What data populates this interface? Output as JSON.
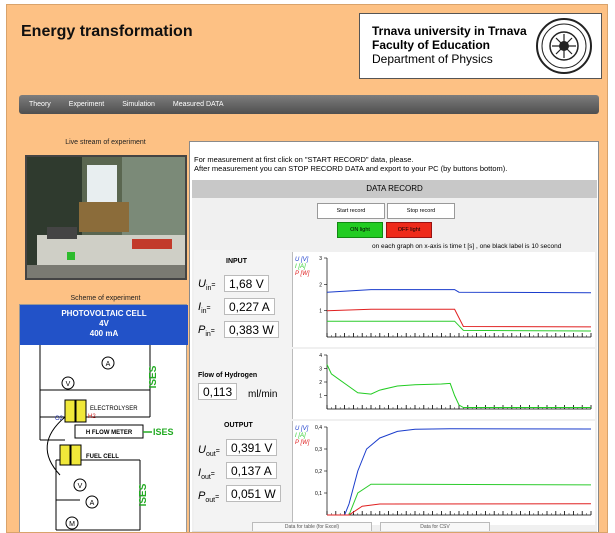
{
  "header": {
    "title": "Energy transformation",
    "university_line1": "Trnava university in Trnava",
    "university_line2": "Faculty of Education",
    "university_line3": "Department of Physics"
  },
  "nav": {
    "items": [
      "Theory",
      "Experiment",
      "Simulation",
      "Measured DATA"
    ]
  },
  "left": {
    "live_label": "Live stream of experiment",
    "scheme_label": "Scheme of experiment",
    "scheme": {
      "pv_title": "PHOTOVOLTAIC CELL",
      "pv_voltage": "4V",
      "pv_current": "400 mA",
      "ammeter": "A",
      "voltmeter": "V",
      "motor": "M",
      "ises": "ISES",
      "electrolyser": "ELECTROLYSER",
      "o2": "O2",
      "h2": "H2",
      "flow_meter": "H FLOW METER",
      "fuel_cell": "FUEL CELL"
    }
  },
  "panel": {
    "instruction_1": "For measurement at first click on \"START RECORD\" data, please.",
    "instruction_2": "After measurement you can STOP RECORD DATA and export to your PC (by buttons bottom).",
    "header": "DATA RECORD",
    "start_label": "Start record",
    "stop_label": "Stop record",
    "on_label": "ON light",
    "off_label": "OFF light",
    "graph_note": "on each graph on x-axis is time t [s] , one black label is 10 second",
    "input": {
      "title": "INPUT",
      "u_label": "U",
      "u_sub": "in",
      "u_value": "1,68 V",
      "i_label": "I",
      "i_sub": "in",
      "i_value": "0,227 A",
      "p_label": "P",
      "p_sub": "in",
      "p_value": "0,383 W"
    },
    "flow": {
      "title": "Flow of Hydrogen",
      "value": "0,113",
      "unit": "ml/min"
    },
    "output": {
      "title": "OUTPUT",
      "u_label": "U",
      "u_sub": "out",
      "u_value": "0,391 V",
      "i_label": "I",
      "i_sub": "out",
      "i_value": "0,137 A",
      "p_label": "P",
      "p_sub": "out",
      "p_value": "0,051 W"
    },
    "export_excel": "Data for table (for Excel)",
    "export_csv": "Data for CSV"
  },
  "legend": {
    "u": "U [V]",
    "i": "I [A]",
    "p": "P [W]"
  },
  "colors": {
    "u": "#1a3ccc",
    "i": "#2dcc2d",
    "p": "#e02020",
    "h": "#22cc22"
  },
  "chart_data": [
    {
      "type": "line",
      "ylim": [
        0,
        3
      ],
      "yticks": [
        "1",
        "2",
        "3"
      ],
      "series": [
        {
          "name": "U [V]",
          "x": [
            0,
            50,
            100,
            145,
            150,
            300
          ],
          "y": [
            1.7,
            1.8,
            1.8,
            1.8,
            1.7,
            1.68
          ]
        },
        {
          "name": "I [A]",
          "x": [
            0,
            50,
            100,
            145,
            155,
            300
          ],
          "y": [
            0.6,
            0.6,
            0.6,
            0.6,
            0.25,
            0.227
          ]
        },
        {
          "name": "P [W]",
          "x": [
            0,
            50,
            100,
            145,
            155,
            300
          ],
          "y": [
            1.0,
            1.05,
            1.05,
            1.05,
            0.4,
            0.383
          ]
        }
      ]
    },
    {
      "type": "line",
      "ylim": [
        0,
        4
      ],
      "yticks": [
        "1",
        "2",
        "3",
        "4"
      ],
      "series": [
        {
          "x": [
            0,
            5,
            20,
            35,
            50,
            60,
            80,
            100,
            130,
            140,
            145,
            150,
            155,
            300
          ],
          "y": [
            3.3,
            2.6,
            1.9,
            1.2,
            1.1,
            1.4,
            1.7,
            1.8,
            1.85,
            1.9,
            1.0,
            0.3,
            0.11,
            0.113
          ]
        }
      ]
    },
    {
      "type": "line",
      "ylim": [
        0,
        0.4
      ],
      "yticks": [
        "0,1",
        "0,2",
        "0,3",
        "0,4"
      ],
      "series": [
        {
          "name": "U [V]",
          "x": [
            0,
            20,
            25,
            35,
            45,
            60,
            80,
            100,
            140,
            300
          ],
          "y": [
            0,
            0,
            0.05,
            0.2,
            0.3,
            0.35,
            0.38,
            0.39,
            0.392,
            0.391
          ]
        },
        {
          "name": "I [A]",
          "x": [
            0,
            25,
            35,
            50,
            80,
            300
          ],
          "y": [
            0,
            0,
            0.1,
            0.14,
            0.14,
            0.137
          ]
        },
        {
          "name": "P [W]",
          "x": [
            0,
            25,
            40,
            60,
            300
          ],
          "y": [
            0,
            0,
            0.04,
            0.05,
            0.051
          ]
        }
      ]
    }
  ]
}
